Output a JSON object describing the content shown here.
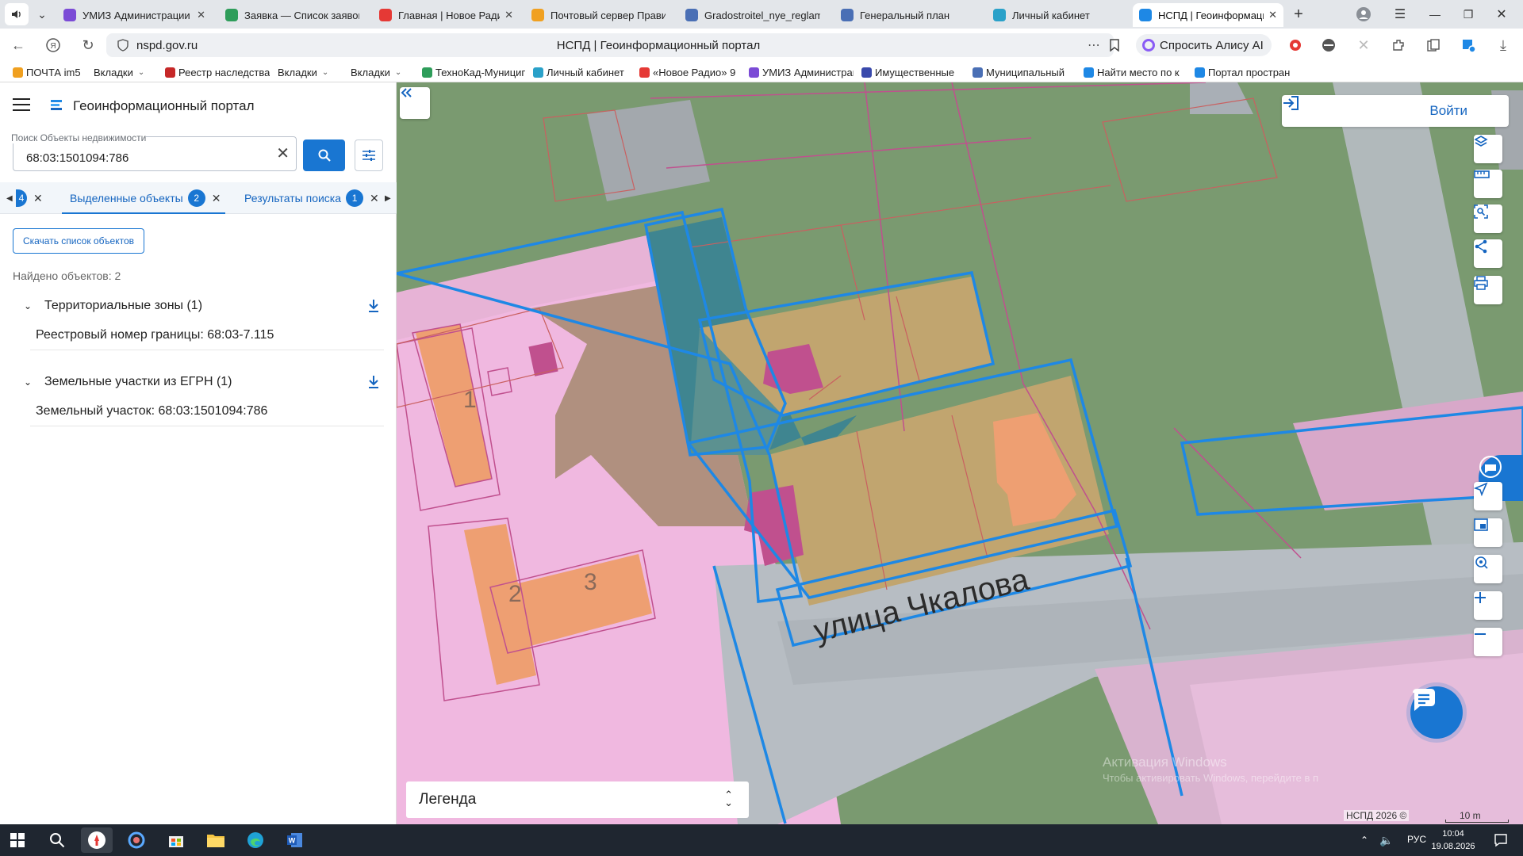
{
  "browser": {
    "tabs": [
      {
        "title": "УМИЗ Администрации",
        "color": "#7b4bd6",
        "active": false
      },
      {
        "title": "Заявка — Список заявок",
        "color": "#2e9d5a",
        "active": false
      },
      {
        "title": "Главная | Новое Радио",
        "color": "#e53935",
        "active": false
      },
      {
        "title": "Почтовый сервер Правительства",
        "color": "#f0a020",
        "active": false
      },
      {
        "title": "Gradostroitel_nye_reglamenty",
        "color": "#4a6fb5",
        "active": false
      },
      {
        "title": "Генеральный план",
        "color": "#4a6fb5",
        "active": false
      },
      {
        "title": "Личный кабинет",
        "color": "#2aa1c9",
        "active": false
      },
      {
        "title": "НСПД | Геоинформационный",
        "color": "#1e88e5",
        "active": true
      }
    ],
    "url": "nspd.gov.ru",
    "page_title": "НСПД | Геоинформационный портал",
    "alice_label": "Спросить Алису AI",
    "bookmarks": [
      {
        "label": "ПОЧТА im5",
        "color": "#f0a020",
        "chevron": false
      },
      {
        "label": "Вкладки",
        "color": null,
        "chevron": true
      },
      {
        "label": "Реестр наследства",
        "color": "#c62828",
        "chevron": false
      },
      {
        "label": "Вкладки",
        "color": null,
        "chevron": true
      },
      {
        "label": "Вкладки",
        "color": null,
        "chevron": true
      },
      {
        "label": "ТехноКад-Муниципалитет",
        "color": "#2e9d5a",
        "chevron": false
      },
      {
        "label": "Личный кабинет",
        "color": "#2aa1c9",
        "chevron": false
      },
      {
        "label": "«Новое Радио» 9",
        "color": "#e53935",
        "chevron": false
      },
      {
        "label": "УМИЗ Администрации",
        "color": "#7b4bd6",
        "chevron": false
      },
      {
        "label": "Имущественные",
        "color": "#3949ab",
        "chevron": false
      },
      {
        "label": "Муниципальный",
        "color": "#4a6fb5",
        "chevron": false
      },
      {
        "label": "Найти место по к",
        "color": "#1e88e5",
        "chevron": false
      },
      {
        "label": "Портал простран",
        "color": "#1e88e5",
        "chevron": false
      }
    ]
  },
  "panel": {
    "title": "Геоинформационный портал",
    "search": {
      "label": "Поиск Объекты недвижимости",
      "value": "68:03:1501094:786"
    },
    "tabs": {
      "left_badge": "4",
      "selected": {
        "label": "Выделенные объекты",
        "count": "2"
      },
      "results": {
        "label": "Результаты поиска",
        "count": "1"
      }
    },
    "download_list_label": "Скачать список объектов",
    "found_label": "Найдено объектов: 2",
    "groups": [
      {
        "title": "Территориальные зоны (1)",
        "item": "Реестровый номер границы: 68:03-7.115"
      },
      {
        "title": "Земельные участки из ЕГРН (1)",
        "item": "Земельный участок: 68:03:1501094:786"
      }
    ]
  },
  "map": {
    "login_label": "Войти",
    "legend_label": "Легенда",
    "street_label": "улица Чкалова",
    "building_numbers": [
      "1",
      "2",
      "3"
    ],
    "copyright": "НСПД 2026 ©",
    "scale": "10 m",
    "watermark_line1": "Активация Windows",
    "watermark_line2": "Чтобы активировать Windows, перейдите в п",
    "colors": {
      "accent": "#1976d2",
      "zone_green": "#7a9a70",
      "zone_pink": "#f0b8e0",
      "parcel_tan": "#c1a56f",
      "building_orange": "#ee9f72",
      "building_magenta": "#c0508e",
      "selected_outline": "#1e88e5"
    },
    "controls": [
      "layers-icon",
      "ruler-icon",
      "search-area-icon",
      "share-icon",
      "print-icon",
      "locate-icon",
      "minimap-icon",
      "geo-search-icon",
      "zoom-in-icon",
      "zoom-out-icon"
    ]
  },
  "taskbar": {
    "lang": "РУС",
    "time": "10:04",
    "date": "19.08.2026"
  }
}
